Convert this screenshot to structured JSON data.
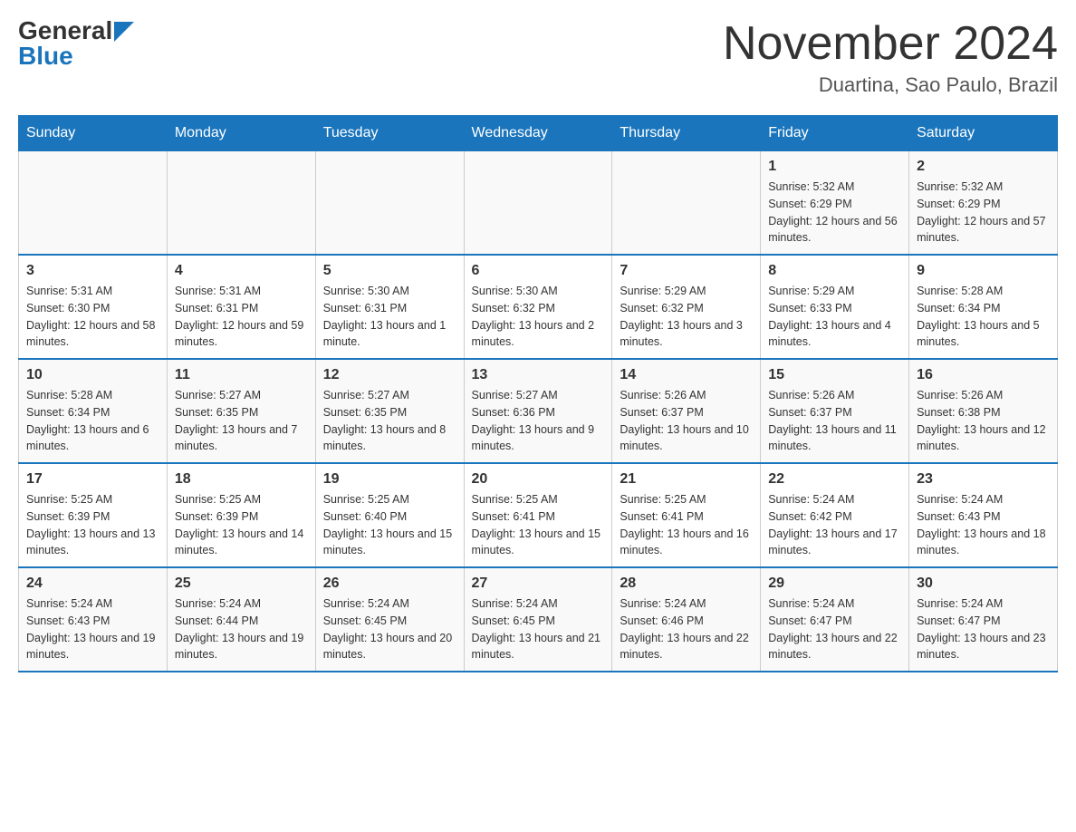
{
  "header": {
    "logo_general": "General",
    "logo_blue": "Blue",
    "title": "November 2024",
    "subtitle": "Duartina, Sao Paulo, Brazil"
  },
  "days_of_week": [
    "Sunday",
    "Monday",
    "Tuesday",
    "Wednesday",
    "Thursday",
    "Friday",
    "Saturday"
  ],
  "weeks": [
    [
      {
        "day": "",
        "info": ""
      },
      {
        "day": "",
        "info": ""
      },
      {
        "day": "",
        "info": ""
      },
      {
        "day": "",
        "info": ""
      },
      {
        "day": "",
        "info": ""
      },
      {
        "day": "1",
        "info": "Sunrise: 5:32 AM\nSunset: 6:29 PM\nDaylight: 12 hours and 56 minutes."
      },
      {
        "day": "2",
        "info": "Sunrise: 5:32 AM\nSunset: 6:29 PM\nDaylight: 12 hours and 57 minutes."
      }
    ],
    [
      {
        "day": "3",
        "info": "Sunrise: 5:31 AM\nSunset: 6:30 PM\nDaylight: 12 hours and 58 minutes."
      },
      {
        "day": "4",
        "info": "Sunrise: 5:31 AM\nSunset: 6:31 PM\nDaylight: 12 hours and 59 minutes."
      },
      {
        "day": "5",
        "info": "Sunrise: 5:30 AM\nSunset: 6:31 PM\nDaylight: 13 hours and 1 minute."
      },
      {
        "day": "6",
        "info": "Sunrise: 5:30 AM\nSunset: 6:32 PM\nDaylight: 13 hours and 2 minutes."
      },
      {
        "day": "7",
        "info": "Sunrise: 5:29 AM\nSunset: 6:32 PM\nDaylight: 13 hours and 3 minutes."
      },
      {
        "day": "8",
        "info": "Sunrise: 5:29 AM\nSunset: 6:33 PM\nDaylight: 13 hours and 4 minutes."
      },
      {
        "day": "9",
        "info": "Sunrise: 5:28 AM\nSunset: 6:34 PM\nDaylight: 13 hours and 5 minutes."
      }
    ],
    [
      {
        "day": "10",
        "info": "Sunrise: 5:28 AM\nSunset: 6:34 PM\nDaylight: 13 hours and 6 minutes."
      },
      {
        "day": "11",
        "info": "Sunrise: 5:27 AM\nSunset: 6:35 PM\nDaylight: 13 hours and 7 minutes."
      },
      {
        "day": "12",
        "info": "Sunrise: 5:27 AM\nSunset: 6:35 PM\nDaylight: 13 hours and 8 minutes."
      },
      {
        "day": "13",
        "info": "Sunrise: 5:27 AM\nSunset: 6:36 PM\nDaylight: 13 hours and 9 minutes."
      },
      {
        "day": "14",
        "info": "Sunrise: 5:26 AM\nSunset: 6:37 PM\nDaylight: 13 hours and 10 minutes."
      },
      {
        "day": "15",
        "info": "Sunrise: 5:26 AM\nSunset: 6:37 PM\nDaylight: 13 hours and 11 minutes."
      },
      {
        "day": "16",
        "info": "Sunrise: 5:26 AM\nSunset: 6:38 PM\nDaylight: 13 hours and 12 minutes."
      }
    ],
    [
      {
        "day": "17",
        "info": "Sunrise: 5:25 AM\nSunset: 6:39 PM\nDaylight: 13 hours and 13 minutes."
      },
      {
        "day": "18",
        "info": "Sunrise: 5:25 AM\nSunset: 6:39 PM\nDaylight: 13 hours and 14 minutes."
      },
      {
        "day": "19",
        "info": "Sunrise: 5:25 AM\nSunset: 6:40 PM\nDaylight: 13 hours and 15 minutes."
      },
      {
        "day": "20",
        "info": "Sunrise: 5:25 AM\nSunset: 6:41 PM\nDaylight: 13 hours and 15 minutes."
      },
      {
        "day": "21",
        "info": "Sunrise: 5:25 AM\nSunset: 6:41 PM\nDaylight: 13 hours and 16 minutes."
      },
      {
        "day": "22",
        "info": "Sunrise: 5:24 AM\nSunset: 6:42 PM\nDaylight: 13 hours and 17 minutes."
      },
      {
        "day": "23",
        "info": "Sunrise: 5:24 AM\nSunset: 6:43 PM\nDaylight: 13 hours and 18 minutes."
      }
    ],
    [
      {
        "day": "24",
        "info": "Sunrise: 5:24 AM\nSunset: 6:43 PM\nDaylight: 13 hours and 19 minutes."
      },
      {
        "day": "25",
        "info": "Sunrise: 5:24 AM\nSunset: 6:44 PM\nDaylight: 13 hours and 19 minutes."
      },
      {
        "day": "26",
        "info": "Sunrise: 5:24 AM\nSunset: 6:45 PM\nDaylight: 13 hours and 20 minutes."
      },
      {
        "day": "27",
        "info": "Sunrise: 5:24 AM\nSunset: 6:45 PM\nDaylight: 13 hours and 21 minutes."
      },
      {
        "day": "28",
        "info": "Sunrise: 5:24 AM\nSunset: 6:46 PM\nDaylight: 13 hours and 22 minutes."
      },
      {
        "day": "29",
        "info": "Sunrise: 5:24 AM\nSunset: 6:47 PM\nDaylight: 13 hours and 22 minutes."
      },
      {
        "day": "30",
        "info": "Sunrise: 5:24 AM\nSunset: 6:47 PM\nDaylight: 13 hours and 23 minutes."
      }
    ]
  ]
}
